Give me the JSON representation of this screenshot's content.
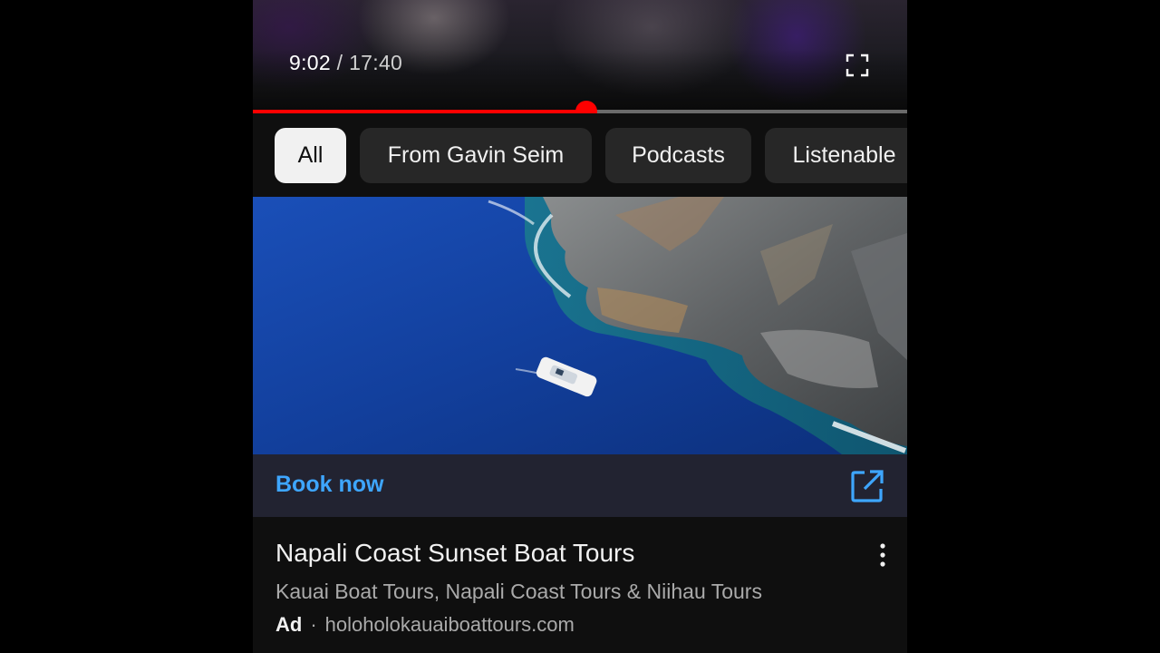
{
  "player": {
    "current_time": "9:02",
    "separator": "/",
    "duration": "17:40",
    "progress_fraction": 0.51,
    "fullscreen_icon": "fullscreen-icon"
  },
  "chips": [
    {
      "label": "All",
      "selected": true
    },
    {
      "label": "From Gavin Seim",
      "selected": false
    },
    {
      "label": "Podcasts",
      "selected": false
    },
    {
      "label": "Listenable",
      "selected": false
    }
  ],
  "ad": {
    "cta_label": "Book now",
    "cta_icon": "open-in-new-icon",
    "title": "Napali Coast Sunset Boat Tours",
    "subtitle": "Kauai Boat Tours, Napali Coast Tours & Niihau Tours",
    "badge": "Ad",
    "domain": "holoholokauaiboattours.com",
    "menu_icon": "more-vert-icon"
  },
  "colors": {
    "background": "#0f0f0f",
    "progress": "#ff0000",
    "link_blue": "#3ea6ff",
    "chip_bg": "#272727",
    "chip_active_bg": "#f1f1f1",
    "cta_bar_bg": "#222331"
  }
}
